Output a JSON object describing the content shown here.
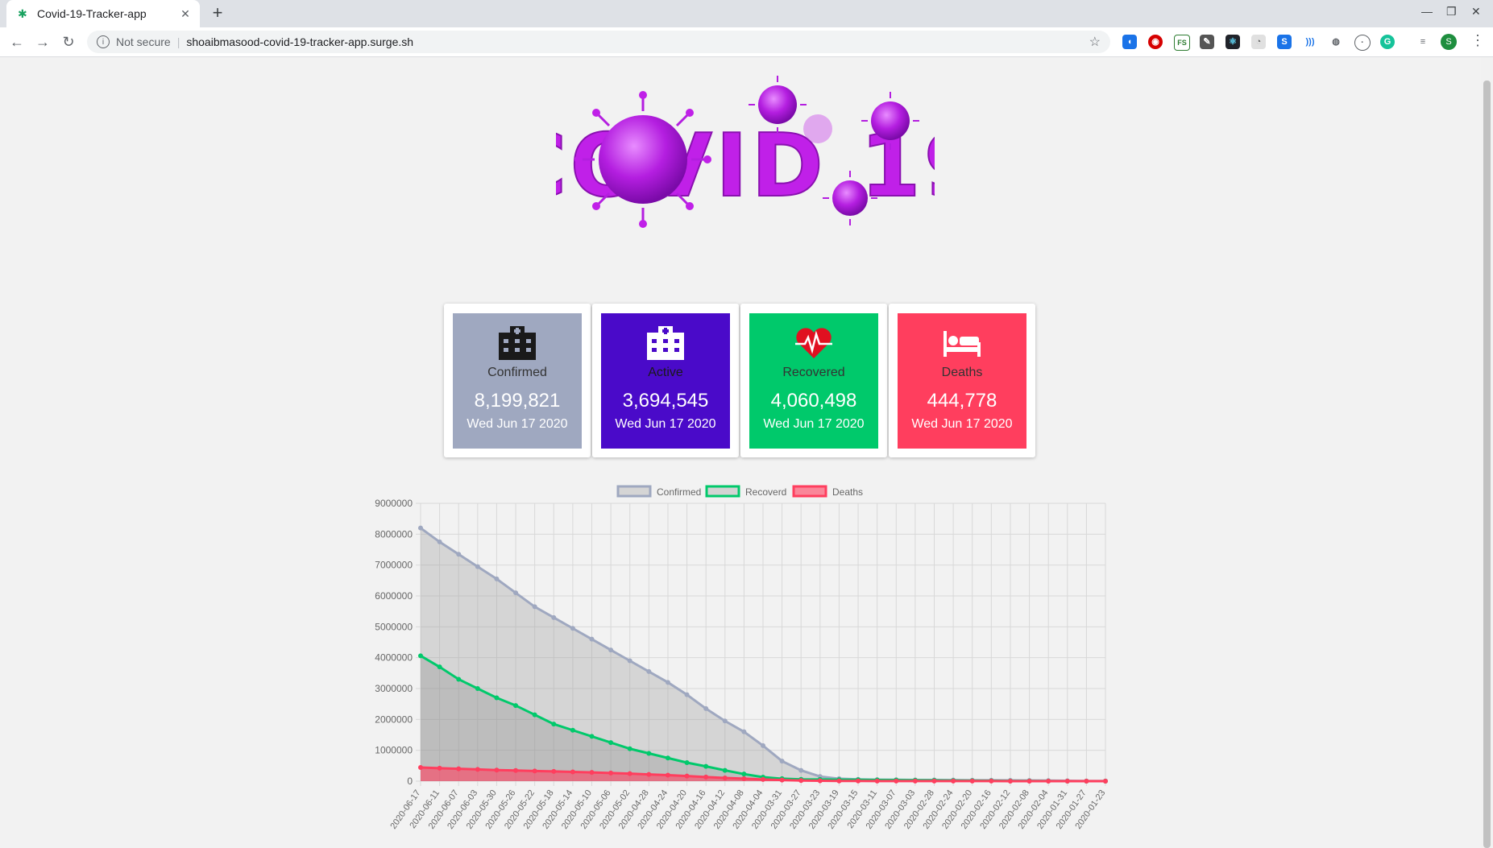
{
  "browser": {
    "tab_title": "Covid-19-Tracker-app",
    "security_label": "Not secure",
    "url": "shoaibmasood-covid-19-tracker-app.surge.sh",
    "avatar_letter": "S"
  },
  "logo": {
    "text": "COVID 19",
    "color": "#c020e8"
  },
  "cards": [
    {
      "label": "Confirmed",
      "value": "8,199,821",
      "date": "Wed Jun 17 2020",
      "bg": "#9fa8c0",
      "label_color": "#333333",
      "icon": "hospital-icon"
    },
    {
      "label": "Active",
      "value": "3,694,545",
      "date": "Wed Jun 17 2020",
      "bg": "#4a0ac9",
      "label_color": "#1a1a1a",
      "icon": "hospital-icon"
    },
    {
      "label": "Recovered",
      "value": "4,060,498",
      "date": "Wed Jun 17 2020",
      "bg": "#00c96b",
      "label_color": "#333333",
      "icon": "heartbeat-icon"
    },
    {
      "label": "Deaths",
      "value": "444,778",
      "date": "Wed Jun 17 2020",
      "bg": "#ff3e5e",
      "label_color": "#333333",
      "icon": "bed-icon"
    }
  ],
  "chart_data": {
    "type": "line",
    "legend": [
      "Confirmed",
      "Recoverd",
      "Deaths"
    ],
    "legend_position": "top",
    "grid": true,
    "ylim": [
      0,
      9000000
    ],
    "yticks": [
      "9000000",
      "8000000",
      "7000000",
      "6000000",
      "5000000",
      "4000000",
      "3000000",
      "2000000",
      "1000000",
      "0"
    ],
    "xticks": [
      "2020-06-17",
      "2020-06-11",
      "2020-06-07",
      "2020-06-03",
      "2020-05-30",
      "2020-05-26",
      "2020-05-22",
      "2020-05-18",
      "2020-05-14",
      "2020-05-10",
      "2020-05-06",
      "2020-05-02",
      "2020-04-28",
      "2020-04-24",
      "2020-04-20",
      "2020-04-16",
      "2020-04-12",
      "2020-04-08",
      "2020-04-04",
      "2020-03-31",
      "2020-03-27",
      "2020-03-23",
      "2020-03-19",
      "2020-03-15",
      "2020-03-11",
      "2020-03-07",
      "2020-03-03",
      "2020-02-28",
      "2020-02-24",
      "2020-02-20",
      "2020-02-16",
      "2020-02-12",
      "2020-02-08",
      "2020-02-04",
      "2020-01-31",
      "2020-01-27",
      "2020-01-23"
    ],
    "series": [
      {
        "name": "Confirmed",
        "color": "#9fa8c0",
        "fill": "rgba(160,160,160,0.35)",
        "values": [
          8199821,
          7750000,
          7350000,
          6950000,
          6550000,
          6100000,
          5650000,
          5300000,
          4950000,
          4600000,
          4250000,
          3900000,
          3550000,
          3200000,
          2800000,
          2350000,
          1950000,
          1600000,
          1150000,
          650000,
          350000,
          150000,
          80000,
          60000,
          50000,
          45000,
          40000,
          38000,
          35000,
          30000,
          28000,
          25000,
          22000,
          18000,
          12000,
          8000,
          5000
        ]
      },
      {
        "name": "Recoverd",
        "color": "#00c96b",
        "fill": "rgba(120,120,120,0.25)",
        "values": [
          4060498,
          3700000,
          3300000,
          3000000,
          2700000,
          2450000,
          2150000,
          1850000,
          1650000,
          1450000,
          1250000,
          1050000,
          900000,
          750000,
          600000,
          480000,
          350000,
          230000,
          130000,
          80000,
          60000,
          55000,
          50000,
          45000,
          40000,
          35000,
          30000,
          25000,
          20000,
          16000,
          12000,
          8000,
          5000,
          3000,
          1500,
          500,
          100
        ]
      },
      {
        "name": "Deaths",
        "color": "#ff3e5e",
        "fill": "rgba(255,62,94,0.6)",
        "values": [
          444778,
          420000,
          400000,
          380000,
          360000,
          345000,
          330000,
          315000,
          300000,
          285000,
          265000,
          245000,
          220000,
          195000,
          165000,
          135000,
          105000,
          80000,
          55000,
          35000,
          20000,
          12000,
          8000,
          5000,
          4000,
          3500,
          3000,
          2800,
          2500,
          2200,
          1800,
          1400,
          1000,
          600,
          300,
          150,
          50
        ]
      }
    ]
  }
}
